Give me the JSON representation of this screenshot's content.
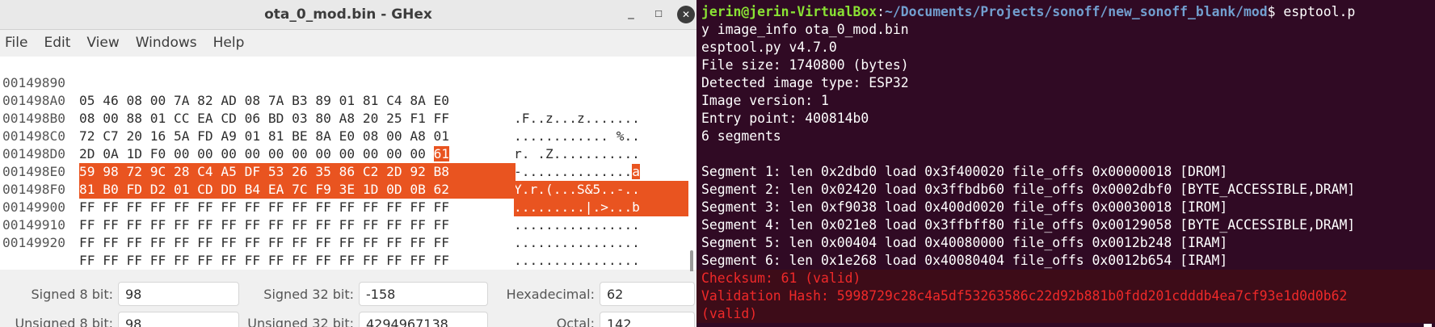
{
  "ghex": {
    "title": "ota_0_mod.bin - GHex",
    "minimize": "_",
    "maximize": "☐",
    "close": "✕",
    "menu": [
      "File",
      "Edit",
      "View",
      "Windows",
      "Help"
    ],
    "rows": [
      {
        "offset": "00149890",
        "hex": "05 46 08 00 7A 82 AD 08 7A B3 89 01 81 C4 8A E0",
        "ascii": ".F..z...z.......",
        "selected": false
      },
      {
        "offset": "001498A0",
        "hex": "08 00 88 01 CC EA CD 06 BD 03 80 A8 20 25 F1 FF",
        "ascii": "............ %..",
        "selected": false
      },
      {
        "offset": "001498B0",
        "hex": "72 C7 20 16 5A FD A9 01 81 BE 8A E0 08 00 A8 01",
        "ascii": "r. .Z...........",
        "selected": false
      },
      {
        "offset": "001498C0",
        "hex": "2D 0A 1D F0 00 00 00 00 00 00 00 00 00 00 00 61",
        "ascii": "-..............a",
        "selected": false
      },
      {
        "offset": "001498D0",
        "hex": "59 98 72 9C 28 C4 A5 DF 53 26 35 86 C2 2D 92 B8",
        "ascii": "Y.r.(...S&5..-..",
        "selected": true
      },
      {
        "offset": "001498E0",
        "hex": "81 B0 FD D2 01 CD DD B4 EA 7C F9 3E 1D 0D 0B 62",
        "ascii": ".........|.>...b",
        "selected": true
      },
      {
        "offset": "001498F0",
        "hex": "FF FF FF FF FF FF FF FF FF FF FF FF FF FF FF FF",
        "ascii": "................",
        "selected": false
      },
      {
        "offset": "00149900",
        "hex": "FF FF FF FF FF FF FF FF FF FF FF FF FF FF FF FF",
        "ascii": "................",
        "selected": false
      },
      {
        "offset": "00149910",
        "hex": "FF FF FF FF FF FF FF FF FF FF FF FF FF FF FF FF",
        "ascii": "................",
        "selected": false
      },
      {
        "offset": "00149920",
        "hex": "FF FF FF FF FF FF FF FF FF FF FF FF FF FF FF FF",
        "ascii": "................",
        "selected": false
      }
    ],
    "row3_partial": {
      "hex": "2D 0A 1D F0 00 00 00 00 00 00 00 00 00 00 00 ",
      "sel_hex": "61",
      "ascii": "-..............",
      "sel_ascii": "a"
    },
    "fields": {
      "signed8_label": "Signed 8 bit:",
      "signed8_value": "98",
      "signed32_label": "Signed 32 bit:",
      "signed32_value": "-158",
      "hexadecimal_label": "Hexadecimal:",
      "hexadecimal_value": "62",
      "unsigned8_label": "Unsigned 8 bit:",
      "unsigned8_value": "98",
      "unsigned32_label": "Unsigned 32 bit:",
      "unsigned32_value": "4294967138",
      "octal_label": "Octal:",
      "octal_value": "142"
    }
  },
  "terminal": {
    "prompt_user": "jerin@jerin-VirtualBox",
    "prompt_sep": ":",
    "prompt_path": "~/Documents/Projects/sonoff/new_sonoff_blank/mod",
    "prompt_cmd": "$ esptool.p",
    "lines": [
      "y image_info ota_0_mod.bin",
      "esptool.py v4.7.0",
      "File size: 1740800 (bytes)",
      "Detected image type: ESP32",
      "Image version: 1",
      "Entry point: 400814b0",
      "6 segments",
      "",
      "Segment 1: len 0x2dbd0 load 0x3f400020 file_offs 0x00000018 [DROM]",
      "Segment 2: len 0x02420 load 0x3ffbdb60 file_offs 0x0002dbf0 [BYTE_ACCESSIBLE,DRAM]",
      "Segment 3: len 0xf9038 load 0x400d0020 file_offs 0x00030018 [IROM]",
      "Segment 4: len 0x021e8 load 0x3ffbff80 file_offs 0x00129058 [BYTE_ACCESSIBLE,DRAM]",
      "Segment 5: len 0x00404 load 0x40080000 file_offs 0x0012b248 [IRAM]",
      "Segment 6: len 0x1e268 load 0x40080404 file_offs 0x0012b654 [IRAM]"
    ],
    "error_lines": [
      "Checksum: 61 (valid)",
      "Validation Hash: 5998729c28c4a5df53263586c22d92b881b0fdd201cdddb4ea7cf93e1d0d0b62",
      "(valid)"
    ],
    "colors": {
      "background": "#300a24",
      "user": "#8ae234",
      "path": "#729fcf",
      "error": "#ef2929",
      "selection": "#e95420"
    }
  }
}
